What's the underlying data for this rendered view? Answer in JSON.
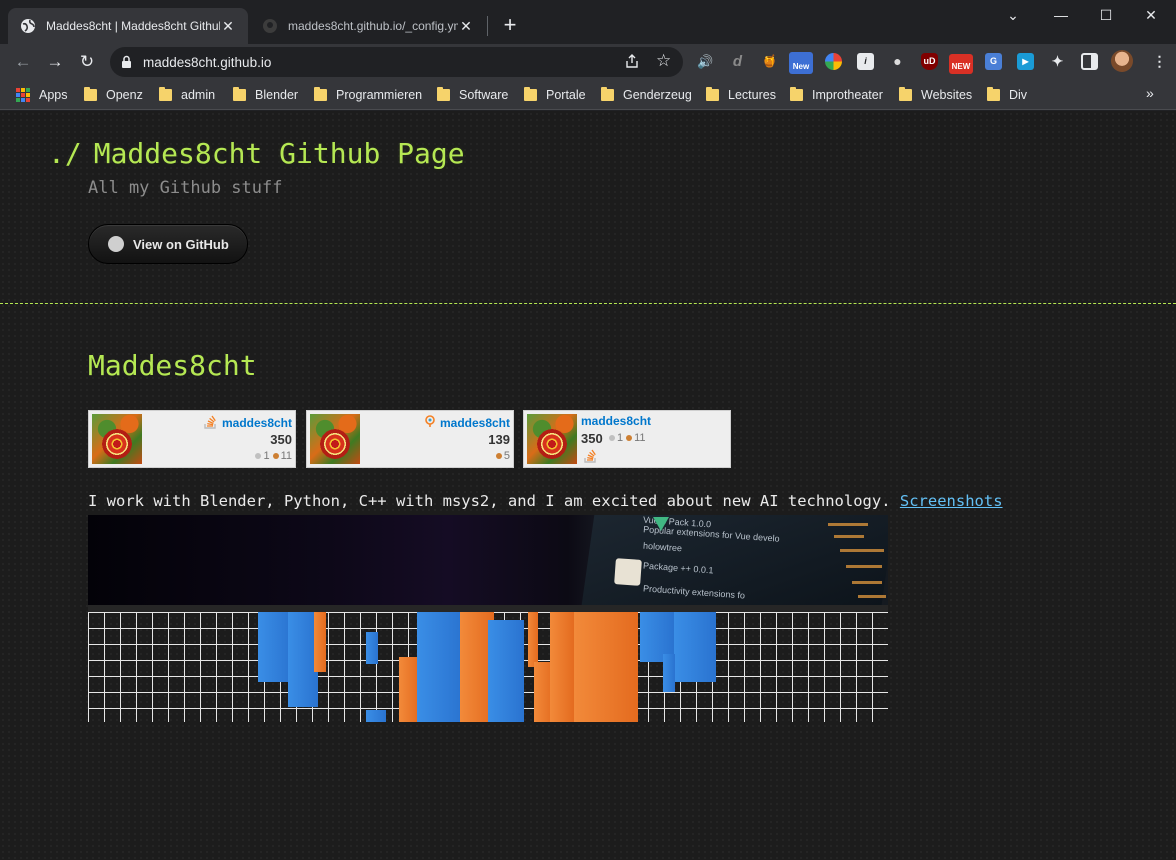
{
  "browser": {
    "tabs": [
      {
        "title": "Maddes8cht | Maddes8cht Github",
        "active": true
      },
      {
        "title": "maddes8cht.github.io/_config.ym",
        "active": false
      }
    ],
    "url": "maddes8cht.github.io",
    "extensions": [
      {
        "icon": "speaker-icon",
        "label": "🔊"
      },
      {
        "icon": "d-extension-icon",
        "label": "d"
      },
      {
        "icon": "honey-icon",
        "label": "🍯"
      },
      {
        "icon": "new-badge-extension-icon",
        "label": "New"
      },
      {
        "icon": "compass-extension-icon",
        "label": ""
      },
      {
        "icon": "info-extension-icon",
        "label": "i"
      },
      {
        "icon": "ball-extension-icon",
        "label": "●"
      },
      {
        "icon": "ublock-icon",
        "label": "uD"
      },
      {
        "icon": "new-extension-icon",
        "label": "NEW"
      },
      {
        "icon": "translate-icon",
        "label": "G"
      },
      {
        "icon": "cast-extension-icon",
        "label": "▶"
      },
      {
        "icon": "puzzle-icon",
        "label": "✦"
      },
      {
        "icon": "sidepanel-icon",
        "label": ""
      },
      {
        "icon": "profile-avatar-icon",
        "label": ""
      }
    ],
    "bookmarks": [
      {
        "label": "Apps",
        "type": "apps"
      },
      {
        "label": "Openz",
        "type": "folder"
      },
      {
        "label": "admin",
        "type": "folder"
      },
      {
        "label": "Blender",
        "type": "folder"
      },
      {
        "label": "Programmieren",
        "type": "folder"
      },
      {
        "label": "Software",
        "type": "folder"
      },
      {
        "label": "Portale",
        "type": "folder"
      },
      {
        "label": "Genderzeug",
        "type": "folder"
      },
      {
        "label": "Lectures",
        "type": "folder"
      },
      {
        "label": "Improtheater",
        "type": "folder"
      },
      {
        "label": "Websites",
        "type": "folder"
      },
      {
        "label": "Div",
        "type": "folder"
      }
    ]
  },
  "page": {
    "title_prefix": "./",
    "title": "Maddes8cht Github Page",
    "description": "All my Github stuff",
    "github_button": "View on GitHub",
    "heading": "Maddes8cht",
    "flairs": [
      {
        "site": "stackoverflow",
        "user": "maddes8cht",
        "rep": "350",
        "silver": "1",
        "bronze": "11"
      },
      {
        "site": "superuser",
        "user": "maddes8cht",
        "rep": "139",
        "bronze": "5"
      },
      {
        "site": "stackoverflow",
        "user": "maddes8cht",
        "rep": "350",
        "silver": "1",
        "bronze": "11"
      }
    ],
    "intro_text": "I work with Blender, Python, C++ with msys2, and I am excited about new AI technology.",
    "intro_link": "Screenshots",
    "banner1_text": [
      "Vue 3 Pack 1.0.0",
      "Popular extensions for Vue develo",
      "holowtree",
      "Package ++ 0.0.1",
      "Productivity extensions fo"
    ]
  },
  "colors": {
    "accent_green": "#b5e853",
    "link_blue": "#63c0f5",
    "page_bg": "#1c1c1c"
  }
}
